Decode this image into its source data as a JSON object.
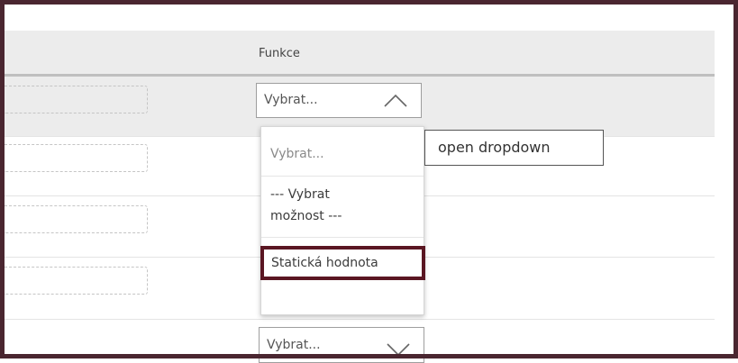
{
  "table": {
    "column_header": "Funkce",
    "row_select_value": "Vybrat...",
    "bottom_select_value": "Vybrat..."
  },
  "dropdown": {
    "options": [
      {
        "label": "Vybrat...",
        "placeholder": true
      },
      {
        "label": "--- Vybrat možnost ---"
      },
      {
        "label": "Statická hodnota",
        "highlighted": true
      }
    ]
  },
  "tooltip": {
    "text": "open dropdown"
  },
  "icons": {
    "select_open": "chevron-up-icon",
    "select_closed": "chevron-down-icon"
  },
  "colors": {
    "highlight_border": "#5a1622",
    "frame": "#4a2630"
  }
}
